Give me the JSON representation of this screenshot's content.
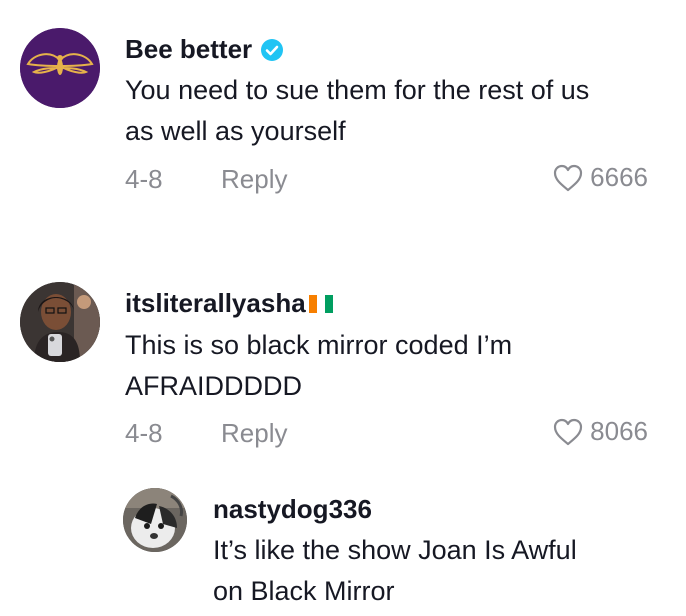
{
  "comments": [
    {
      "username": "Bee better",
      "verified": true,
      "text_lines": [
        "You need to sue them for the rest of us",
        "as well as yourself"
      ],
      "date": "4-8",
      "reply_label": "Reply",
      "likes": "6666",
      "avatar_color": "#4a1a6b",
      "icons": [
        "bee-logo-icon",
        "verified-badge-icon",
        "heart-outline-icon"
      ]
    },
    {
      "username": "itsliterallyasha",
      "flag": "ivory-coast-flag",
      "text_lines": [
        "This is so black mirror coded I’m",
        "AFRAIDDDDD"
      ],
      "date": "4-8",
      "reply_label": "Reply",
      "likes": "8066",
      "icons": [
        "profile-photo",
        "heart-outline-icon"
      ]
    },
    {
      "username": "nastydog336",
      "text_lines": [
        "It’s like the show Joan Is Awful",
        "on Black Mirror"
      ],
      "icons": [
        "profile-photo"
      ]
    }
  ],
  "colors": {
    "text": "#161823",
    "muted": "#8a8b91",
    "verified": "#20c4f4"
  }
}
